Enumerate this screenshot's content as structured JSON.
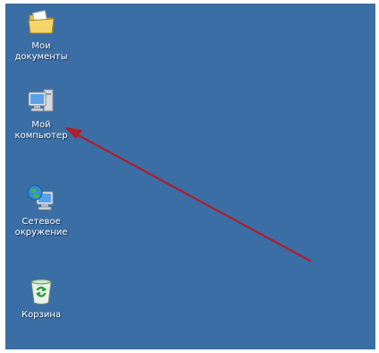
{
  "desktop": {
    "background_color": "#3a6ea5",
    "icons": [
      {
        "label": "Мои\nдокументы",
        "icon": "my-documents-folder-icon"
      },
      {
        "label": "Мой\nкомпьютер",
        "icon": "my-computer-icon"
      },
      {
        "label": "Сетевое\nокружение",
        "icon": "network-places-icon"
      },
      {
        "label": "Корзина",
        "icon": "recycle-bin-icon"
      }
    ]
  },
  "annotation": {
    "arrow_color": "#b01e2a"
  }
}
